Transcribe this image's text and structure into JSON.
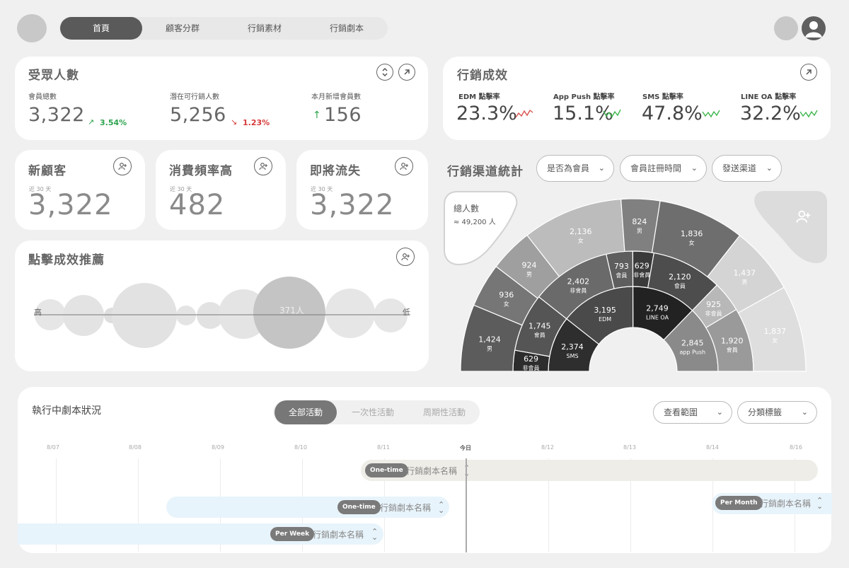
{
  "nav": {
    "tabs": [
      "首頁",
      "顧客分群",
      "行銷素材",
      "行銷劇本"
    ],
    "active_tab": 0
  },
  "audience": {
    "title": "受眾人數",
    "metrics": [
      {
        "label": "會員總數",
        "value": "3,322",
        "delta": "3.54%",
        "trend": "up"
      },
      {
        "label": "潛在可行銷人數",
        "value": "5,256",
        "delta": "1.23%",
        "trend": "down"
      },
      {
        "label": "本月新增會員數",
        "value": "156",
        "trend": "up"
      }
    ]
  },
  "performance": {
    "title": "行銷成效",
    "metrics": [
      {
        "label": "EDM 點擊率",
        "value": "23.3%",
        "spark_color": "#d9534f"
      },
      {
        "label": "App Push 點擊率",
        "value": "15.1%",
        "spark_color": "#3cb64a"
      },
      {
        "label": "SMS 點擊率",
        "value": "47.8%",
        "spark_color": "#3cb64a"
      },
      {
        "label": "LINE OA 點擊率",
        "value": "32.2%",
        "spark_color": "#3cb64a"
      }
    ]
  },
  "segments": [
    {
      "title": "新顧客",
      "period": "近 30 天",
      "value": "3,322"
    },
    {
      "title": "消費頻率高",
      "period": "近 30 天",
      "value": "482"
    },
    {
      "title": "即將流失",
      "period": "近 30 天",
      "value": "3,322"
    }
  ],
  "click_reco": {
    "title": "點擊成效推薦",
    "high_label": "高",
    "low_label": "低",
    "center_value": "371人"
  },
  "channel": {
    "title": "行銷渠道統計",
    "filters": [
      "是否為會員",
      "會員註冊時間",
      "發送渠道"
    ],
    "total_label": "總人數",
    "total_value": "≈ 49,200 人"
  },
  "chart_data": {
    "type": "sunburst",
    "rings": [
      {
        "name": "channel",
        "slices": [
          {
            "label": "SMS",
            "value": "2,374"
          },
          {
            "label": "EDM",
            "value": "3,195"
          },
          {
            "label": "LINE OA",
            "value": "2,749"
          },
          {
            "label": "app Push",
            "value": "2,845"
          }
        ]
      },
      {
        "name": "membership",
        "slices": [
          {
            "label": "非會員",
            "value": "629"
          },
          {
            "label": "會員",
            "value": "1,745"
          },
          {
            "label": "非會員",
            "value": "2,402"
          },
          {
            "label": "會員",
            "value": "793"
          },
          {
            "label": "非會員",
            "value": "629"
          },
          {
            "label": "會員",
            "value": "2,120"
          },
          {
            "label": "非會員",
            "value": "925"
          },
          {
            "label": "會員",
            "value": "1,920"
          }
        ]
      },
      {
        "name": "gender",
        "slices": [
          {
            "label": "男",
            "value": "1,424"
          },
          {
            "label": "女",
            "value": "936"
          },
          {
            "label": "男",
            "value": "924"
          },
          {
            "label": "女",
            "value": "2,136"
          },
          {
            "label": "男",
            "value": "824"
          },
          {
            "label": "女",
            "value": "1,836"
          },
          {
            "label": "男",
            "value": "1,437"
          },
          {
            "label": "女",
            "value": "1,837"
          }
        ]
      }
    ]
  },
  "scripts": {
    "title": "執行中劇本狀況",
    "tabs": [
      "全部活動",
      "一次性活動",
      "周期性活動"
    ],
    "active_tab": 0,
    "filters": [
      "查看範圍",
      "分類標籤"
    ],
    "days": [
      "8/07",
      "8/08",
      "8/09",
      "8/10",
      "8/11",
      "今日",
      "8/12",
      "8/13",
      "8/14",
      "8/16"
    ],
    "bars": [
      {
        "type": "One-time",
        "name": "行銷劇本名稱"
      },
      {
        "type": "One-time",
        "name": "行銷劇本名稱"
      },
      {
        "type": "Per Month",
        "name": "行銷劇本名稱"
      },
      {
        "type": "Per Week",
        "name": "行銷劇本名稱"
      }
    ]
  }
}
